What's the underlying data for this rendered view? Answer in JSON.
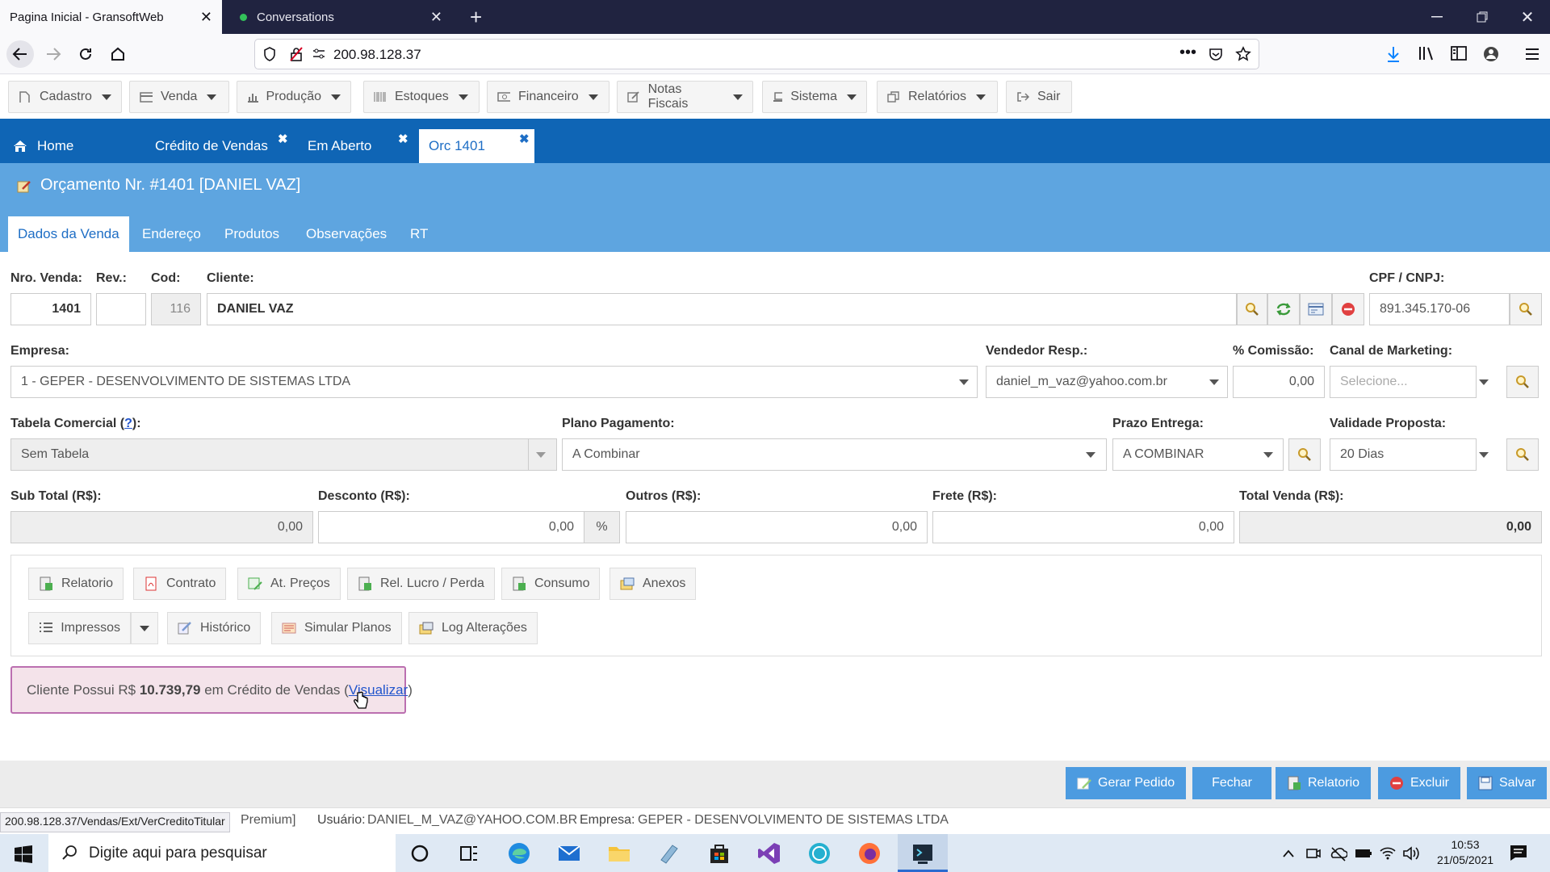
{
  "browser": {
    "tabs": [
      {
        "title": "Pagina Inicial - GransoftWeb",
        "active": true
      },
      {
        "title": "Conversations",
        "active": false
      }
    ],
    "url": "200.98.128.37",
    "hover_url": "200.98.128.37/Vendas/Ext/VerCreditoTitular"
  },
  "menu": {
    "items": [
      "Cadastro",
      "Venda",
      "Produção",
      "Estoques",
      "Financeiro",
      "Notas Fiscais",
      "Sistema",
      "Relatórios",
      "Sair"
    ]
  },
  "app_tabs": {
    "home": "Home",
    "tabs": [
      "Crédito de Vendas",
      "Em Aberto",
      "Orc 1401"
    ]
  },
  "page": {
    "title": "Orçamento Nr. #1401 [DANIEL VAZ]",
    "subtabs": [
      "Dados da Venda",
      "Endereço",
      "Produtos",
      "Observações",
      "RT"
    ]
  },
  "form": {
    "nro_venda": {
      "label": "Nro. Venda:",
      "value": "1401"
    },
    "rev": {
      "label": "Rev.:",
      "value": ""
    },
    "cod": {
      "label": "Cod:",
      "value": "116"
    },
    "cliente": {
      "label": "Cliente:",
      "value": "DANIEL VAZ"
    },
    "cpf": {
      "label": "CPF / CNPJ:",
      "value": "891.345.170-06"
    },
    "empresa": {
      "label": "Empresa:",
      "value": "1 - GEPER - DESENVOLVIMENTO DE SISTEMAS LTDA"
    },
    "vendedor": {
      "label": "Vendedor Resp.:",
      "value": "daniel_m_vaz@yahoo.com.br"
    },
    "comissao": {
      "label": "% Comissão:",
      "value": "0,00"
    },
    "canal": {
      "label": "Canal de Marketing:",
      "placeholder": "Selecione..."
    },
    "tabela": {
      "label_prefix": "Tabela Comercial (",
      "label_help": "?",
      "label_suffix": "):",
      "value": "Sem Tabela"
    },
    "plano": {
      "label": "Plano Pagamento:",
      "value": "A Combinar"
    },
    "prazo": {
      "label": "Prazo Entrega:",
      "value": "A COMBINAR"
    },
    "validade": {
      "label": "Validade Proposta:",
      "value": "20 Dias"
    },
    "subtotal": {
      "label": "Sub Total (R$):",
      "value": "0,00"
    },
    "desconto": {
      "label": "Desconto (R$):",
      "value": "0,00",
      "pct": "%"
    },
    "outros": {
      "label": "Outros (R$):",
      "value": "0,00"
    },
    "frete": {
      "label": "Frete (R$):",
      "value": "0,00"
    },
    "total": {
      "label": "Total Venda (R$):",
      "value": "0,00"
    }
  },
  "actions": {
    "row1": [
      "Relatorio",
      "Contrato",
      "At. Preços",
      "Rel. Lucro / Perda",
      "Consumo",
      "Anexos"
    ],
    "row2": [
      "Impressos",
      "Histórico",
      "Simular Planos",
      "Log Alterações"
    ]
  },
  "alert": {
    "prefix": "Cliente Possui R$ ",
    "amount": "10.739,79",
    "middle": " em Crédito de Vendas (",
    "link": "Visualizar",
    "suffix": ")"
  },
  "footer_buttons": [
    "Gerar Pedido",
    "Fechar",
    "Relatorio",
    "Excluir",
    "Salvar"
  ],
  "status": {
    "premium": "Premium]",
    "usuario_label": "Usuário:",
    "usuario": "DANIEL_M_VAZ@YAHOO.COM.BR",
    "empresa_label": "Empresa:",
    "empresa": "GEPER - DESENVOLVIMENTO DE SISTEMAS LTDA"
  },
  "taskbar": {
    "search_placeholder": "Digite aqui para pesquisar",
    "time": "10:53",
    "date": "21/05/2021"
  },
  "colors": {
    "app_tab_bar": "#0f65b5",
    "page_header": "#5ea5e0",
    "footer_button": "#4c9be0",
    "alert_border": "#bb6fb0",
    "alert_bg": "#f4e3ea"
  }
}
